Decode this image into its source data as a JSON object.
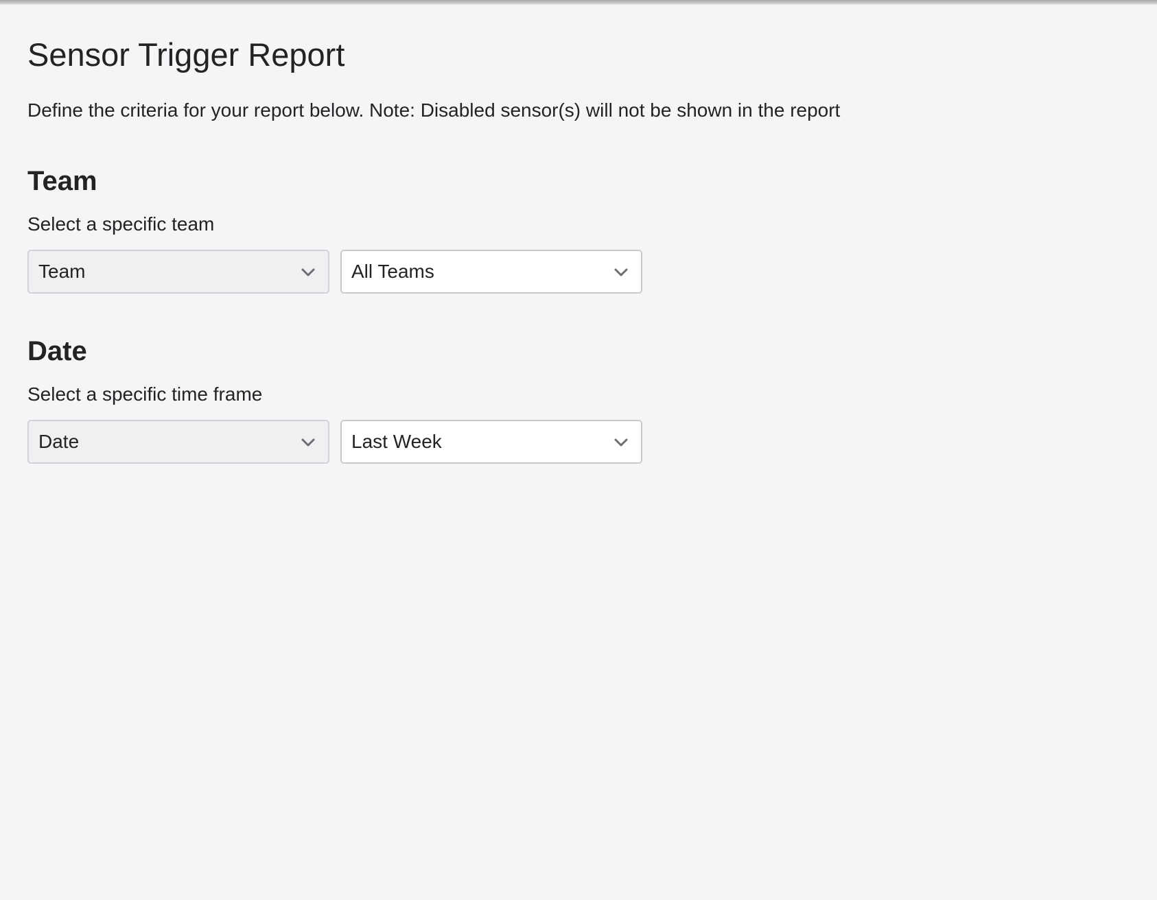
{
  "page": {
    "title": "Sensor Trigger Report",
    "description": "Define the criteria for your report below. Note: Disabled sensor(s) will not be shown in the report"
  },
  "sections": {
    "team": {
      "heading": "Team",
      "subtitle": "Select a specific team",
      "type_select": {
        "value": "Team",
        "icon": "chevron-down-icon"
      },
      "value_select": {
        "value": "All Teams",
        "icon": "chevron-down-icon"
      }
    },
    "date": {
      "heading": "Date",
      "subtitle": "Select a specific time frame",
      "type_select": {
        "value": "Date",
        "icon": "chevron-down-icon"
      },
      "value_select": {
        "value": "Last Week",
        "icon": "chevron-down-icon"
      }
    }
  },
  "colors": {
    "background": "#f4f5f7",
    "text": "#222325",
    "select_border": "#d1d3d6",
    "select_type_bg": "#eff0f2",
    "select_value_bg": "#ffffff",
    "chevron": "#6b6d70"
  }
}
